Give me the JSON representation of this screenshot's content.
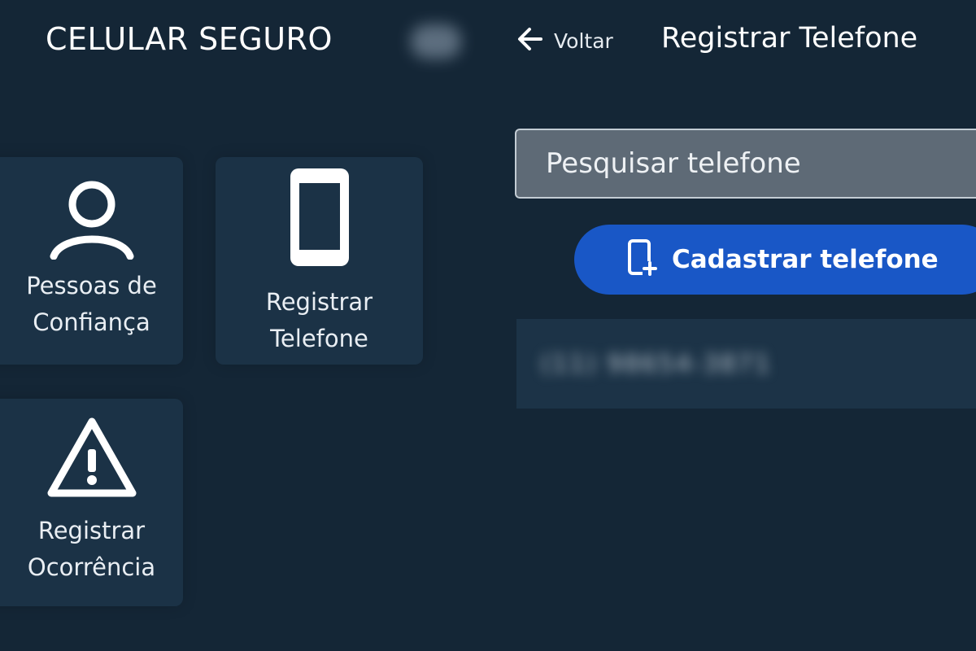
{
  "left_screen": {
    "app_title": "CELULAR SEGURO",
    "tiles": [
      {
        "line1": "Pessoas de",
        "line2": "Confiança",
        "icon": "person-icon"
      },
      {
        "line1": "Registrar",
        "line2": "Telefone",
        "icon": "smartphone-icon"
      },
      {
        "line1": "Registrar",
        "line2": "Ocorrência",
        "icon": "warning-icon"
      }
    ]
  },
  "right_screen": {
    "back_label": "Voltar",
    "back_icon": "arrow-left-icon",
    "title": "Registrar Telefone",
    "search_placeholder": "Pesquisar telefone",
    "add_button_label": "Cadastrar telefone",
    "add_button_icon": "add-phone-icon",
    "registered_phone": "(11) 98654-3871"
  },
  "colors": {
    "background": "#142636",
    "tile": "#1b3246",
    "accent_button": "#1957c6",
    "search_field": "#5e6a76"
  }
}
